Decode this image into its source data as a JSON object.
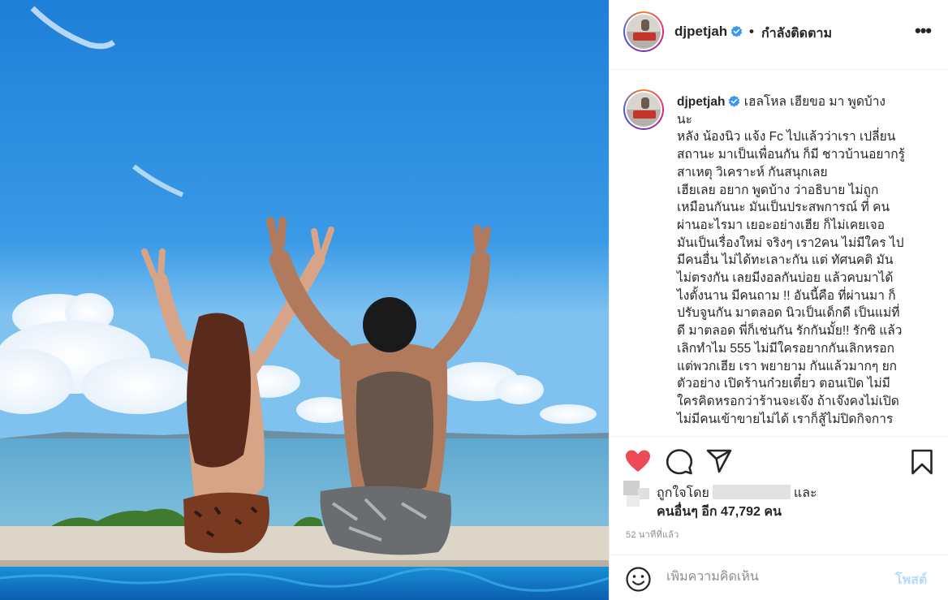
{
  "post": {
    "username": "djpetjah",
    "follow_separator": "•",
    "follow_status": "กำลังติดตาม",
    "more_label": "•••",
    "caption_username": "djpetjah",
    "caption_text": " เฮลโหล เฮียขอ มา พูดบ้าง\nนะ\nหลัง น้องนิว แจ้ง Fc ไปแล้วว่าเรา เปลี่ยน\nสถานะ มาเป็นเพื่อนกัน ก็มี ชาวบ้านอยากรู้\nสาเหตุ วิเคราะห์ กันสนุกเลย\nเฮียเลย อยาก พูดบ้าง ว่าอธิบาย ไม่ถูก\nเหมือนกันนะ มันเป็นประสพการณ์ ที่ คน\nผ่านอะไรมา เยอะอย่างเฮีย ก็ไม่เคยเจอ\nมันเป็นเรื่องใหม่ จริงๆ เรา2คน ไม่มีใคร ไป\nมีคนอื่น ไม่ได้ทะเลาะกัน แต่ ทัศนคติ มัน\nไม่ตรงกัน เลยมีงอลกันบ่อย แล้วคบมาได้\nไงตั้งนาน มีคนถาม !! อันนี้คือ ที่ผ่านมา ก็\nปรับจูนกัน มาตลอด นิวเป็นเด็กดี เป็นแม่ที่\nดี มาตลอด พี่ก็เช่นกัน รักกันมั้ย!! รักซิ แล้ว\nเลิกทำไม 555 ไม่มีใครอยากกันเลิกหรอก\nแต่พวกเฮีย เรา พยายาม กันแล้วมากๆ ยก\nตัวอย่าง เปิดร้านก๋วยเตี๋ยว ตอนเปิด ไม่มี\nใครคิดหรอกว่าร้านจะเจ๊ง ถ้าเจ๊งคงไม่เปิด\nไม่มีคนเข้าขายไม่ได้ เราก็สู้ไม่ปิดกิจการ"
  },
  "engagement": {
    "liked_by_prefix": "ถูกใจโดย",
    "liked_by_suffix": "และ",
    "others_text": "คนอื่นๆ อีก 47,792 คน",
    "time_ago": "52 นาทีที่แล้ว"
  },
  "comment": {
    "placeholder": "เพิ่มความคิดเห็น",
    "post_label": "โพสต์"
  },
  "icons": {
    "like": "heart-filled-icon",
    "comment": "comment-bubble-icon",
    "share": "paper-plane-icon",
    "save": "bookmark-icon",
    "emoji": "emoji-smile-icon",
    "verified": "verified-badge-icon"
  },
  "colors": {
    "like_red": "#ed4956",
    "verified_blue": "#3897f0",
    "post_button_disabled": "#b3dbff",
    "muted_text": "#8e8e8e"
  }
}
